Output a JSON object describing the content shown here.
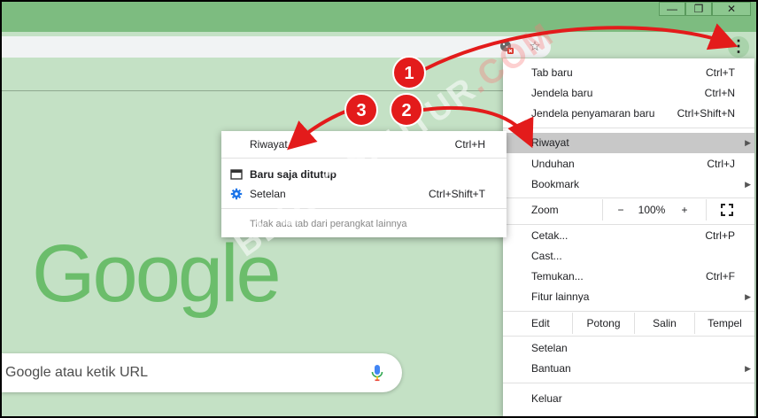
{
  "window": {
    "minimize": "—",
    "maximize": "❐",
    "close": "✕"
  },
  "toolbar": {
    "menu_icon": "⋮",
    "star_icon": "☆"
  },
  "search": {
    "placeholder": "Google atau ketik URL"
  },
  "logo": {
    "text": "Google"
  },
  "menu": {
    "new_tab": {
      "label": "Tab baru",
      "shortcut": "Ctrl+T"
    },
    "new_window": {
      "label": "Jendela baru",
      "shortcut": "Ctrl+N"
    },
    "incognito": {
      "label": "Jendela penyamaran baru",
      "shortcut": "Ctrl+Shift+N"
    },
    "history": {
      "label": "Riwayat"
    },
    "downloads": {
      "label": "Unduhan",
      "shortcut": "Ctrl+J"
    },
    "bookmarks": {
      "label": "Bookmark"
    },
    "zoom": {
      "label": "Zoom",
      "minus": "−",
      "value": "100%",
      "plus": "+"
    },
    "print": {
      "label": "Cetak...",
      "shortcut": "Ctrl+P"
    },
    "cast": {
      "label": "Cast..."
    },
    "find": {
      "label": "Temukan...",
      "shortcut": "Ctrl+F"
    },
    "more_tools": {
      "label": "Fitur lainnya"
    },
    "edit": {
      "label": "Edit",
      "cut": "Potong",
      "copy": "Salin",
      "paste": "Tempel"
    },
    "settings": {
      "label": "Setelan"
    },
    "help": {
      "label": "Bantuan"
    },
    "exit": {
      "label": "Keluar"
    }
  },
  "submenu": {
    "history": {
      "label": "Riwayat",
      "shortcut": "Ctrl+H"
    },
    "recently_closed": {
      "label": "Baru saja ditutup"
    },
    "settings": {
      "label": "Setelan",
      "shortcut": "Ctrl+Shift+T"
    },
    "no_tabs": {
      "label": "Tidak ada tab dari perangkat lainnya"
    }
  },
  "annotations": {
    "markers": [
      "1",
      "2",
      "3"
    ],
    "color": "#e31b1b",
    "watermark": "BLOGODKUTUR",
    "watermark_suffix": ".COM"
  }
}
